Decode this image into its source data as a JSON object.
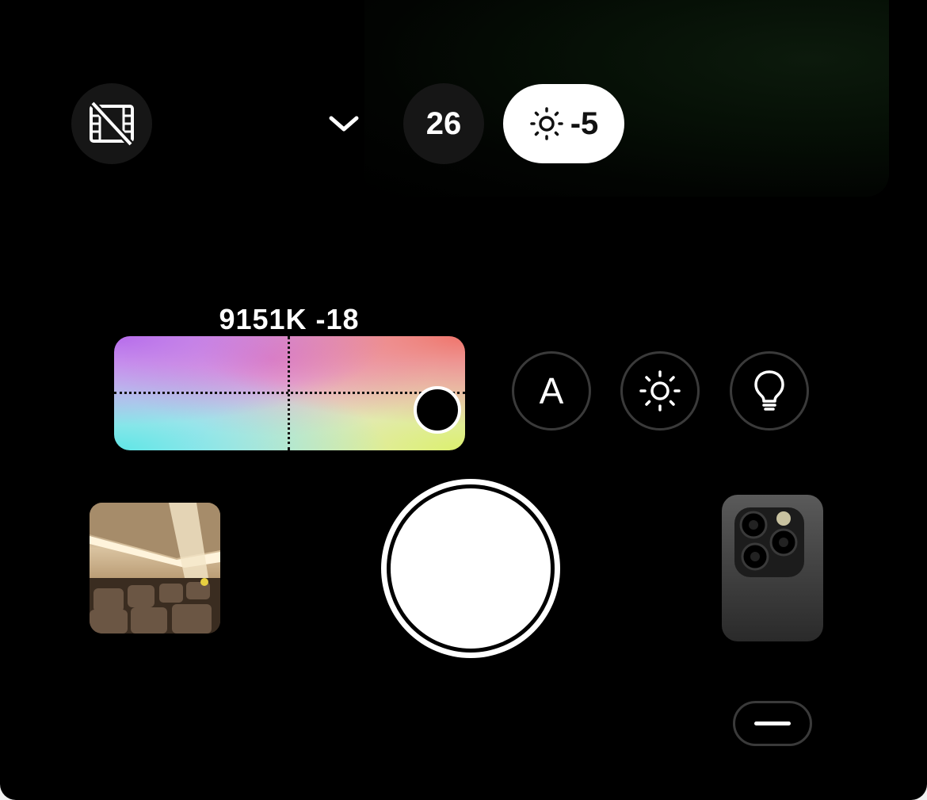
{
  "top_bar": {
    "film_toggle_icon": "video-off-icon",
    "chevron_icon": "chevron-down-icon",
    "iso_value": "26",
    "exposure_icon": "sun-icon",
    "exposure_value": "-5"
  },
  "white_balance": {
    "readout": "9151K -18",
    "knob_position": {
      "temperature_fraction": 0.92,
      "tint_fraction": 0.62
    }
  },
  "modes": {
    "auto_label": "A",
    "exposure_icon": "sun-icon",
    "light_icon": "lightbulb-icon"
  },
  "bottom": {
    "thumbnail_icon": "gallery-thumbnail",
    "shutter_icon": "shutter-button",
    "lens_icon": "camera-lens-icon",
    "menu_icon": "menu-icon"
  },
  "colors": {
    "background": "#000000",
    "accent_pill": "#ffffff",
    "ring": "#3a3a3a"
  }
}
